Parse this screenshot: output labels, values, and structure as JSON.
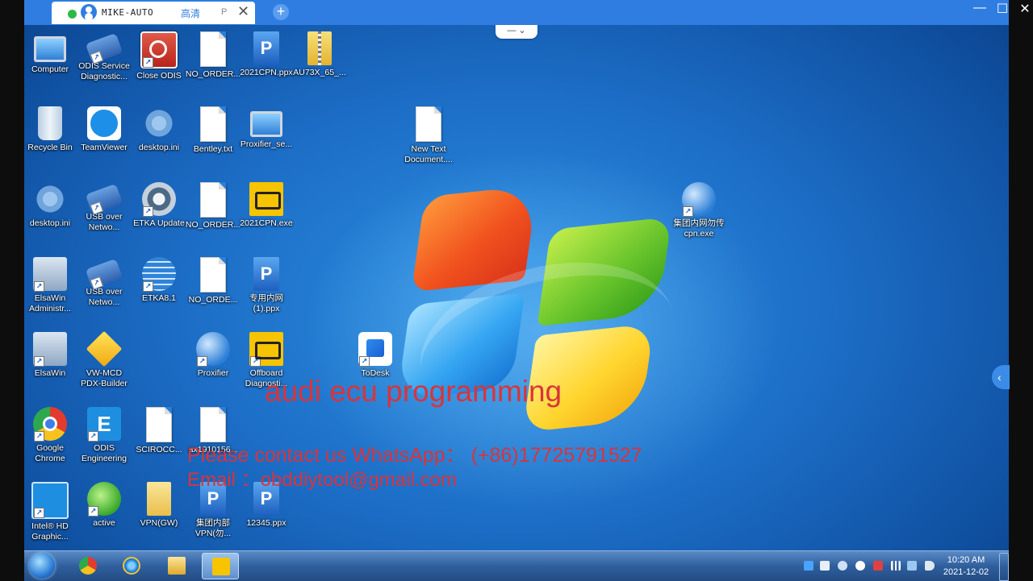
{
  "client": {
    "session_name": "MIKE-AUTO",
    "quality": "高清",
    "tab_extra": "P",
    "close_glyph": "✕",
    "add_glyph": "+",
    "minimize_glyph": "—",
    "maximize_glyph": "☐",
    "window_close_glyph": "✕",
    "toolbar_glyph": "— ⌄",
    "side_handle_glyph": "‹",
    "accent_color": "#2f7de1"
  },
  "desktop": {
    "icons": [
      {
        "label": "Computer",
        "icon": "computer-icon"
      },
      {
        "label": "ODIS Service Diagnostic...",
        "icon": "odis-service-icon"
      },
      {
        "label": "Close ODIS",
        "icon": "close-odis-icon"
      },
      {
        "label": "NO_ORDER...",
        "icon": "text-file-icon"
      },
      {
        "label": "2021CPN.ppx",
        "icon": "ppx-file-icon"
      },
      {
        "label": "AU73X_65_...",
        "icon": "zip-archive-icon"
      },
      {
        "label": "Recycle Bin",
        "icon": "recycle-bin-icon"
      },
      {
        "label": "TeamViewer",
        "icon": "teamviewer-icon"
      },
      {
        "label": "desktop.ini",
        "icon": "settings-file-icon"
      },
      {
        "label": "Bentley.txt",
        "icon": "text-file-icon"
      },
      {
        "label": "Proxifier_se...",
        "icon": "installer-icon"
      },
      {
        "label": "New Text Document....",
        "icon": "text-file-icon"
      },
      {
        "label": "desktop.ini",
        "icon": "settings-file-icon"
      },
      {
        "label": "USB over Netwo...",
        "icon": "usb-network-icon"
      },
      {
        "label": "ETKA Update",
        "icon": "etka-icon"
      },
      {
        "label": "NO_ORDER...",
        "icon": "text-file-icon"
      },
      {
        "label": "2021CPN.exe",
        "icon": "engine-check-icon"
      },
      {
        "label": "集团内网勿传cpn.exe",
        "icon": "proxifier-icon"
      },
      {
        "label": "ElsaWin Administr...",
        "icon": "elsawin-icon"
      },
      {
        "label": "USB over Netwo...",
        "icon": "usb-network-icon"
      },
      {
        "label": "ETKA8.1",
        "icon": "globe-icon"
      },
      {
        "label": "NO_ORDE...",
        "icon": "text-file-icon"
      },
      {
        "label": "专用内网(1).ppx",
        "icon": "ppx-file-icon"
      },
      {
        "label": "ElsaWin",
        "icon": "elsawin-icon"
      },
      {
        "label": "VW-MCD PDX-Builder",
        "icon": "package-icon"
      },
      {
        "label": "Proxifier",
        "icon": "proxifier-icon"
      },
      {
        "label": "Offboard Diagnosti...",
        "icon": "engine-check-icon"
      },
      {
        "label": "ToDesk",
        "icon": "todesk-icon"
      },
      {
        "label": "Google Chrome",
        "icon": "chrome-icon"
      },
      {
        "label": "ODIS Engineering",
        "icon": "odis-engineering-icon"
      },
      {
        "label": "SCIROCC...",
        "icon": "text-file-icon"
      },
      {
        "label": "ax1910156...",
        "icon": "text-file-icon"
      },
      {
        "label": "Intel® HD Graphic...",
        "icon": "intel-graphics-icon"
      },
      {
        "label": "active",
        "icon": "active-icon"
      },
      {
        "label": "VPN(GW)",
        "icon": "folder-icon"
      },
      {
        "label": "集团内部VPN(勿...",
        "icon": "ppx-file-icon"
      },
      {
        "label": "12345.ppx",
        "icon": "ppx-file-icon"
      }
    ]
  },
  "overlay": {
    "title": "audi ecu programming",
    "whatsapp": "Please contact us WhatsApp：  (+86)17725791527",
    "email": "Email  ：obddiytool@gmail.com",
    "color": "#d9343b"
  },
  "taskbar": {
    "time": "10:20 AM",
    "date": "2021-12-02",
    "pinned": [
      {
        "name": "chrome",
        "icon": "chrome-icon"
      },
      {
        "name": "internet-explorer",
        "icon": "internet-explorer-icon"
      },
      {
        "name": "explorer",
        "icon": "folder-icon"
      },
      {
        "name": "offboard-diagnostic",
        "icon": "engine-check-icon",
        "active": true
      }
    ]
  }
}
